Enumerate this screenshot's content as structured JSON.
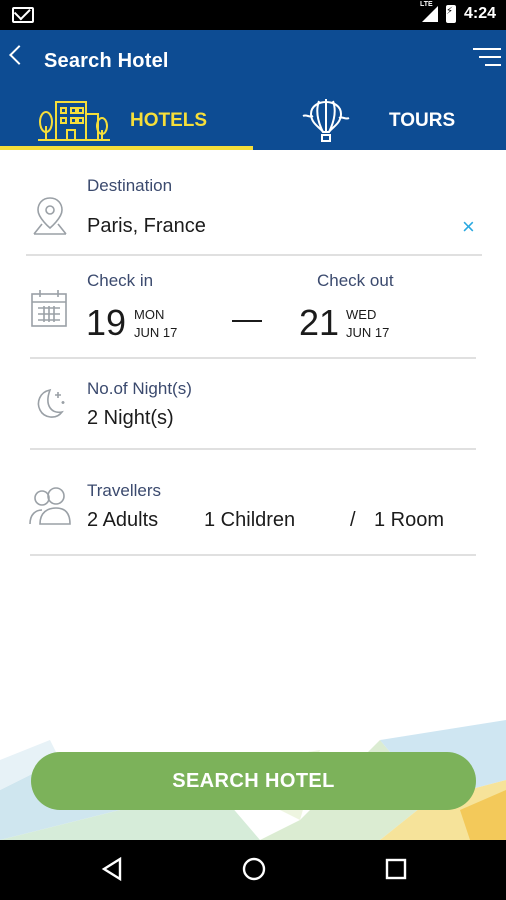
{
  "status_bar": {
    "network": "LTE",
    "time": "4:24"
  },
  "app_bar": {
    "title": "Search Hotel"
  },
  "tabs": [
    {
      "label": "HOTELS",
      "active": true
    },
    {
      "label": "TOURS",
      "active": false
    }
  ],
  "destination": {
    "label": "Destination",
    "value": "Paris, France",
    "clear_icon": "×"
  },
  "dates": {
    "check_in": {
      "label": "Check in",
      "day": "19",
      "weekday": "MON",
      "month_year": "JUN 17"
    },
    "check_out": {
      "label": "Check out",
      "day": "21",
      "weekday": "WED",
      "month_year": "JUN 17"
    }
  },
  "nights": {
    "label": "No.of Night(s)",
    "value": "2 Night(s)"
  },
  "travellers": {
    "label": "Travellers",
    "adults": "2 Adults",
    "children": "1 Children",
    "separator": "/",
    "rooms": "1 Room"
  },
  "search_button": {
    "label": "SEARCH HOTEL"
  },
  "colors": {
    "primary": "#0d4c93",
    "accent": "#f5de3a",
    "button": "#7cb25a",
    "clear": "#29a8e0"
  }
}
